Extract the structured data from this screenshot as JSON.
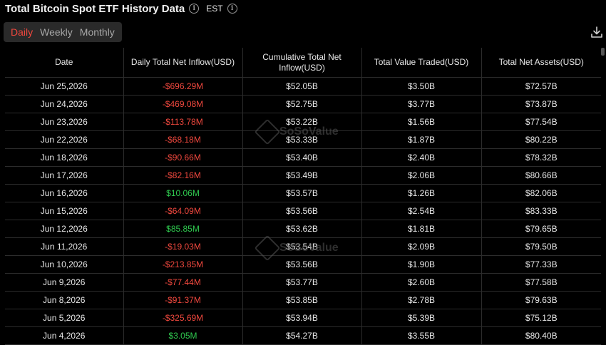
{
  "header": {
    "title": "Total Bitcoin Spot ETF History Data",
    "timezone": "EST"
  },
  "tabs": [
    {
      "label": "Daily",
      "active": true
    },
    {
      "label": "Weekly",
      "active": false
    },
    {
      "label": "Monthly",
      "active": false
    }
  ],
  "watermark": "SoSoValue",
  "table": {
    "columns": [
      "Date",
      "Daily Total Net Inflow(USD)",
      "Cumulative Total Net Inflow(USD)",
      "Total Value Traded(USD)",
      "Total Net Assets(USD)"
    ],
    "rows": [
      [
        "Jun 25,2026",
        "-$696.29M",
        "$52.05B",
        "$3.50B",
        "$72.57B"
      ],
      [
        "Jun 24,2026",
        "-$469.08M",
        "$52.75B",
        "$3.77B",
        "$73.87B"
      ],
      [
        "Jun 23,2026",
        "-$113.78M",
        "$53.22B",
        "$1.56B",
        "$77.54B"
      ],
      [
        "Jun 22,2026",
        "-$68.18M",
        "$53.33B",
        "$1.87B",
        "$80.22B"
      ],
      [
        "Jun 18,2026",
        "-$90.66M",
        "$53.40B",
        "$2.40B",
        "$78.32B"
      ],
      [
        "Jun 17,2026",
        "-$82.16M",
        "$53.49B",
        "$2.06B",
        "$80.66B"
      ],
      [
        "Jun 16,2026",
        "$10.06M",
        "$53.57B",
        "$1.26B",
        "$82.06B"
      ],
      [
        "Jun 15,2026",
        "-$64.09M",
        "$53.56B",
        "$2.54B",
        "$83.33B"
      ],
      [
        "Jun 12,2026",
        "$85.85M",
        "$53.62B",
        "$1.81B",
        "$79.65B"
      ],
      [
        "Jun 11,2026",
        "-$19.03M",
        "$53.54B",
        "$2.09B",
        "$79.50B"
      ],
      [
        "Jun 10,2026",
        "-$213.85M",
        "$53.56B",
        "$1.90B",
        "$77.33B"
      ],
      [
        "Jun 9,2026",
        "-$77.44M",
        "$53.77B",
        "$2.60B",
        "$77.58B"
      ],
      [
        "Jun 8,2026",
        "-$91.37M",
        "$53.85B",
        "$2.78B",
        "$79.63B"
      ],
      [
        "Jun 5,2026",
        "-$325.69M",
        "$53.94B",
        "$5.39B",
        "$75.12B"
      ],
      [
        "Jun 4,2026",
        "$3.05M",
        "$54.27B",
        "$3.55B",
        "$80.40B"
      ]
    ]
  },
  "colors": {
    "accent": "#f0483e",
    "negative": "#f0483e",
    "positive": "#2fca4f",
    "background": "#000000",
    "grid": "#2c2c2c"
  },
  "icons": {
    "info": "info-icon",
    "download": "download-icon"
  }
}
